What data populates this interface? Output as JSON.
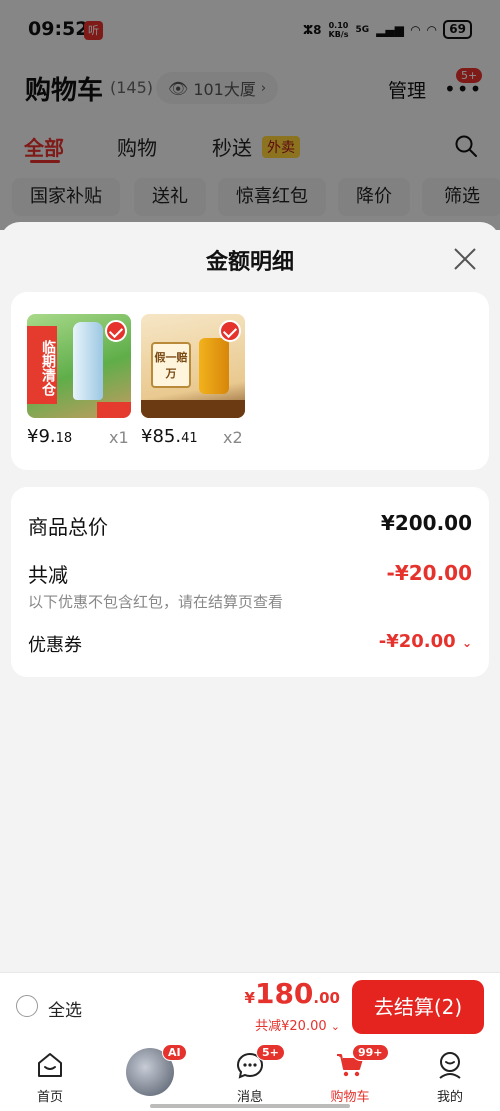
{
  "status": {
    "time": "09:52",
    "app_badge": "听",
    "signal_prefix": "ⵣ8",
    "speed": "0.10",
    "speed_unit": "KB/s",
    "net": "5G",
    "battery": "69"
  },
  "header": {
    "title": "购物车",
    "count": "(145)",
    "address": "101大厦",
    "manage_label": "管理",
    "more_badge": "5+"
  },
  "tabs": {
    "all": "全部",
    "shopping": "购物",
    "flash": "秒送",
    "takeout": "外卖"
  },
  "chips": [
    "国家补贴",
    "送礼",
    "惊喜红包",
    "降价",
    "筛选"
  ],
  "sheet": {
    "title": "金额明细",
    "products": [
      {
        "price_int": "¥9.",
        "price_dec": "18",
        "qty": "x1",
        "img_text": "临期清仓"
      },
      {
        "price_int": "¥85.",
        "price_dec": "41",
        "qty": "x2",
        "img_text": "假一赔万"
      }
    ],
    "detail": {
      "goods_total_label": "商品总价",
      "goods_total_value": "¥200.00",
      "reduce_label": "共减",
      "reduce_value": "-¥20.00",
      "reduce_note": "以下优惠不包含红包，请在结算页查看",
      "coupon_label": "优惠券",
      "coupon_value": "-¥20.00"
    }
  },
  "bottom": {
    "select_all": "全选",
    "total_cur": "¥",
    "total_int": "180",
    "total_dec": ".00",
    "saved": "共减¥20.00",
    "checkout": "去结算(2)"
  },
  "nav": {
    "home": "首页",
    "message": "消息",
    "message_badge": "5+",
    "ai_badge": "AI",
    "cart": "购物车",
    "cart_badge": "99+",
    "mine": "我的"
  },
  "colors": {
    "accent": "#e5322d",
    "takeout_bg": "#ffd23a"
  }
}
